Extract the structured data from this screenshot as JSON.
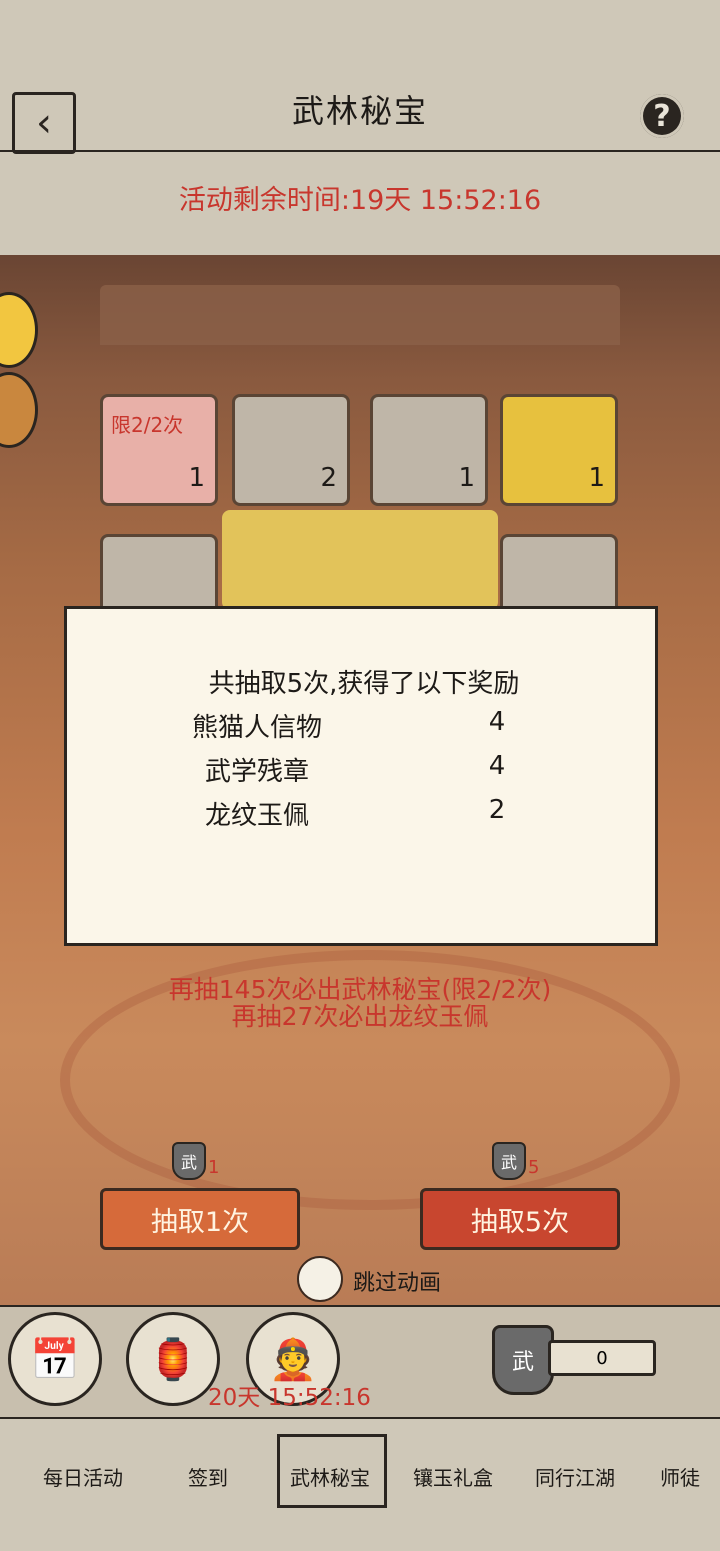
{
  "header": {
    "title": "武林秘宝",
    "back_icon": "back-arrow-icon",
    "help_icon": "help-icon",
    "help_glyph": "?",
    "timer": "活动剩余时间:19天 15:52:16"
  },
  "items": [
    {
      "name": "treasure-chest",
      "count": "1",
      "limit": "限2/2次"
    },
    {
      "name": "martial-manual",
      "count": "2"
    },
    {
      "name": "jade-pendant",
      "count": "1"
    },
    {
      "name": "money-bag",
      "count": "1"
    }
  ],
  "popup": {
    "headline": "共抽取5次,获得了以下奖励",
    "rewards": [
      {
        "name": "熊猫人信物",
        "count": "4"
      },
      {
        "name": "武学残章",
        "count": "4"
      },
      {
        "name": "龙纹玉佩",
        "count": "2"
      }
    ]
  },
  "pity": {
    "line1": "再抽145次必出武林秘宝(限2/2次)",
    "line2": "再抽27次必出龙纹玉佩"
  },
  "draw": {
    "single": {
      "label": "抽取1次",
      "cost": "1",
      "token": "武"
    },
    "multi": {
      "label": "抽取5次",
      "cost": "5",
      "token": "武"
    }
  },
  "skip": {
    "label": "跳过动画"
  },
  "strip": {
    "timer": "20天 15:52:16",
    "token_glyph": "武",
    "token_count": "0"
  },
  "tabs": [
    "每日活动",
    "签到",
    "武林秘宝",
    "镶玉礼盒",
    "同行江湖",
    "师徒"
  ],
  "colors": {
    "accent_red": "#c8362d",
    "button_orange": "#d66a3a",
    "button_red": "#c8462f"
  }
}
